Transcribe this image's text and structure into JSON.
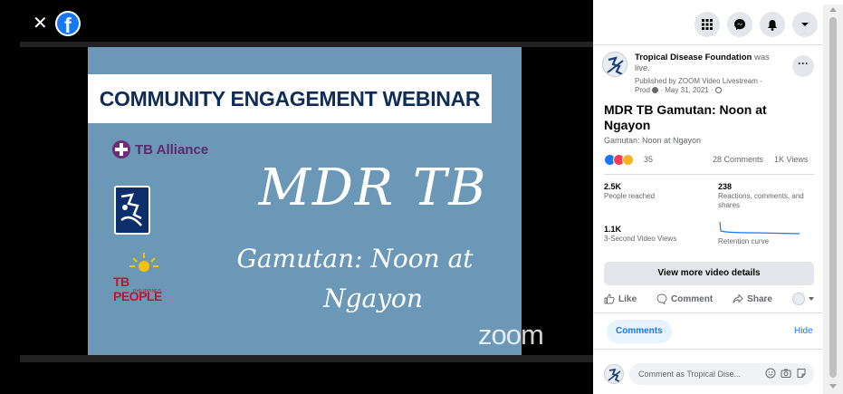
{
  "colors": {
    "facebook_blue": "#1877f2",
    "slide_background": "#6b98b7",
    "slide_header_text": "#102d57",
    "like": "#1877f2",
    "love": "#f33e58",
    "care": "#f7b125"
  },
  "viewer": {
    "close_icon": "close-icon",
    "logo_icon": "facebook-logo-icon"
  },
  "slide": {
    "header": "COMMUNITY ENGAGEMENT WEBINAR",
    "tb_alliance": "TB Alliance",
    "tb_people": "TB PEOPLE",
    "tb_people_sub": "PHILIPPINES",
    "title": "MDR TB",
    "subtitle_line1": "Gamutan: Noon at",
    "subtitle_line2": "Ngayon",
    "watermark": "zoom"
  },
  "top_icons": [
    "menu-grid-icon",
    "messenger-icon",
    "notifications-bell-icon",
    "account-caret-icon"
  ],
  "post": {
    "page_name": "Tropical Disease Foundation",
    "status": " was live.",
    "published_line1": "Published by ZOOM Video Livestream -",
    "published_line2": "Prod",
    "date": "· May 31, 2021 ·",
    "title": "MDR TB Gamutan: Noon at Ngayon",
    "description": "Gamutan: Noon at Ngayon",
    "reactions": {
      "icons": [
        "like-reaction-icon",
        "love-reaction-icon",
        "care-reaction-icon"
      ],
      "count": "35",
      "comments": "28 Comments",
      "views": "1K Views"
    }
  },
  "insights": {
    "people_reached": {
      "value": "2.5K",
      "label": "People reached"
    },
    "engagement": {
      "value": "238",
      "label": "Reactions, comments, and shares"
    },
    "three_sec_views": {
      "value": "1.1K",
      "label": "3-Second Video Views"
    },
    "retention": {
      "label": "Retention curve"
    },
    "details_button": "View more video details"
  },
  "actions": {
    "like": "Like",
    "comment": "Comment",
    "share": "Share"
  },
  "comments": {
    "tab_label": "Comments",
    "hide_label": "Hide",
    "placeholder": "Comment as Tropical Dise...",
    "input_icons": [
      "emoji-icon",
      "camera-icon",
      "sticker-icon"
    ]
  }
}
